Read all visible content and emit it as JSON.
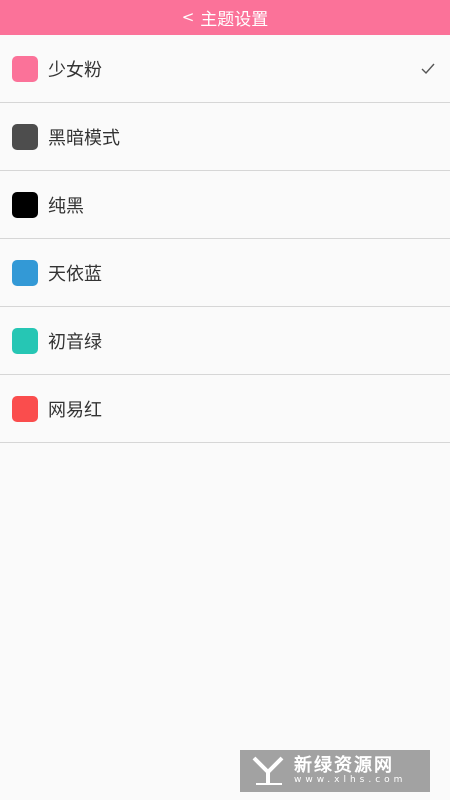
{
  "header": {
    "back_glyph": "<",
    "title": "主题设置",
    "bg_color": "#fb7299"
  },
  "themes": [
    {
      "name": "少女粉",
      "color": "#fb7299",
      "selected": true
    },
    {
      "name": "黑暗模式",
      "color": "#4d4d4d",
      "selected": false
    },
    {
      "name": "纯黑",
      "color": "#000000",
      "selected": false
    },
    {
      "name": "天依蓝",
      "color": "#3399d6",
      "selected": false
    },
    {
      "name": "初音绿",
      "color": "#26c6b4",
      "selected": false
    },
    {
      "name": "网易红",
      "color": "#fa4d4d",
      "selected": false
    }
  ],
  "checkmark_icon": "checkmark-icon",
  "watermark": {
    "main": "新绿资源网",
    "sub": "www.xlhs.com"
  }
}
